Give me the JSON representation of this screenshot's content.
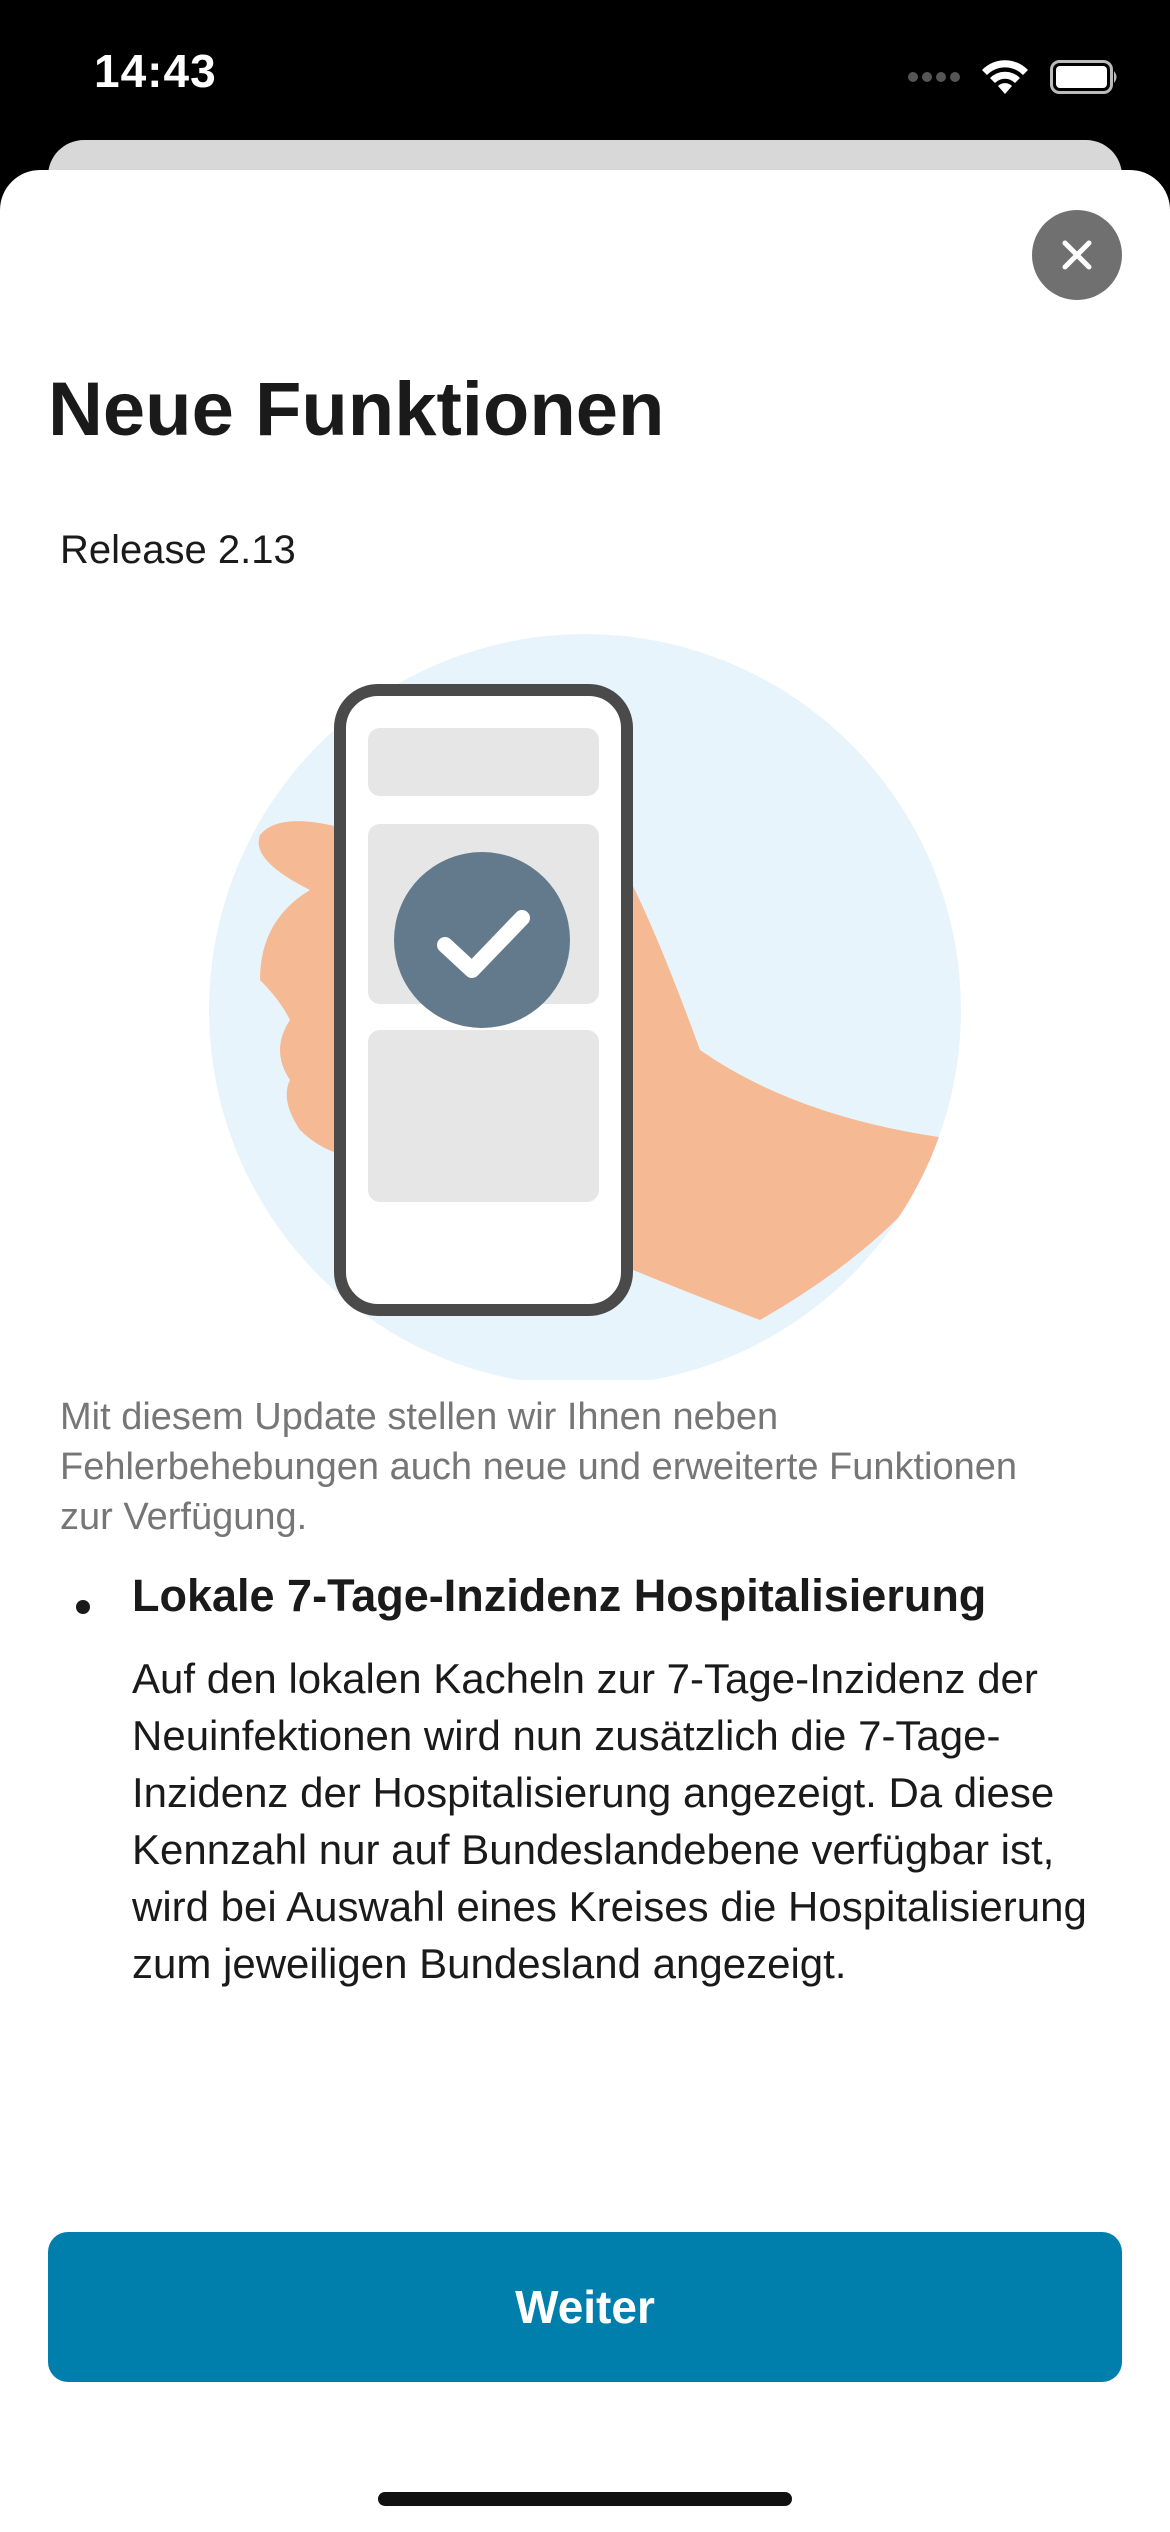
{
  "status_bar": {
    "time": "14:43",
    "icons": [
      "signal-dots-icon",
      "wifi-icon",
      "battery-icon"
    ]
  },
  "sheet": {
    "close_icon": "close-icon",
    "title": "Neue Funktionen",
    "release": "Release 2.13",
    "illustration": "hand-holding-phone-checkmark-illustration",
    "intro": "Mit diesem Update stellen wir Ihnen neben Fehlerbehebungen auch neue und erweiterte Funktionen zur Verfügung.",
    "features": [
      {
        "title": "Lokale 7-Tage-Inzidenz Hospitalisierung",
        "description": "Auf den lokalen Kacheln zur 7-Tage-Inzidenz der Neuinfektionen wird nun zusätzlich die 7-Tage-Inzidenz der Hospitalisierung angezeigt. Da diese Kennzahl nur auf Bundeslandebene verfügbar ist, wird bei Auswahl eines Kreises die Hospitalisierung zum jeweiligen Bundesland angezeigt."
      }
    ],
    "continue_label": "Weiter"
  },
  "colors": {
    "primary_button": "#007fad",
    "close_button": "#707070",
    "illustration_bg": "#e8f4fc",
    "skin": "#f5b994",
    "phone_frame": "#4a4a4a",
    "check_circle": "#637a8c"
  }
}
